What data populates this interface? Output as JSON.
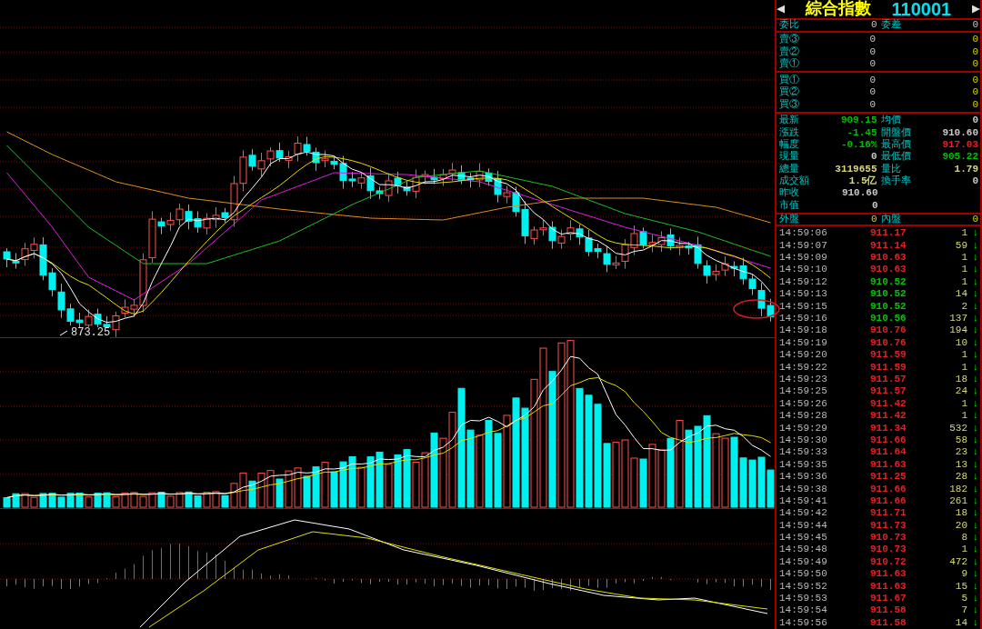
{
  "header": {
    "arrow_left": "◀",
    "title": "綜合指數",
    "code": "110001",
    "arrow_right": "▶"
  },
  "order_ratio": [
    {
      "label": "委比",
      "value": "0"
    },
    {
      "label": "委差",
      "value": "0"
    }
  ],
  "asks": [
    {
      "label": "賣③",
      "price": "0",
      "volume": "0"
    },
    {
      "label": "賣②",
      "price": "0",
      "volume": "0"
    },
    {
      "label": "賣①",
      "price": "0",
      "volume": "0"
    }
  ],
  "bids": [
    {
      "label": "買①",
      "price": "0",
      "volume": "0"
    },
    {
      "label": "買②",
      "price": "0",
      "volume": "0"
    },
    {
      "label": "買③",
      "price": "0",
      "volume": "0"
    }
  ],
  "quote": [
    [
      {
        "label": "最新",
        "value": "909.15",
        "color": "#00c000"
      },
      {
        "label": "均價",
        "value": "0",
        "color": "#c8c8c8"
      }
    ],
    [
      {
        "label": "漲跌",
        "value": "-1.45",
        "color": "#00c000"
      },
      {
        "label": "開盤價",
        "value": "910.60",
        "color": "#c8c8c8"
      }
    ],
    [
      {
        "label": "幅度",
        "value": "-0.16%",
        "color": "#00c000"
      },
      {
        "label": "最高價",
        "value": "917.03",
        "color": "#e82020"
      }
    ],
    [
      {
        "label": "現量",
        "value": "0",
        "color": "#c8c8c8"
      },
      {
        "label": "最低價",
        "value": "905.22",
        "color": "#00c000"
      }
    ],
    [
      {
        "label": "總量",
        "value": "3119655",
        "color": "#d8d878"
      },
      {
        "label": "量比",
        "value": "1.79",
        "color": "#d8d878"
      }
    ],
    [
      {
        "label": "成交額",
        "value": "1.5亿",
        "color": "#d8d878"
      },
      {
        "label": "換手率",
        "value": "0",
        "color": "#c8c8c8"
      }
    ],
    [
      {
        "label": "昨收",
        "value": "910.60",
        "color": "#c8c8c8"
      }
    ],
    [
      {
        "label": "市值",
        "value": "0",
        "color": "#c8c8c8"
      }
    ]
  ],
  "outer_inner": [
    {
      "label": "外盤",
      "value": "0"
    },
    {
      "label": "內盤",
      "value": "0"
    }
  ],
  "ticks": [
    {
      "time": "14:59:06",
      "price": "911.17",
      "color": "#e82020",
      "volume": "1",
      "arrow": "↓"
    },
    {
      "time": "14:59:07",
      "price": "911.14",
      "color": "#e82020",
      "volume": "59",
      "arrow": "↓"
    },
    {
      "time": "14:59:09",
      "price": "910.63",
      "color": "#e82020",
      "volume": "1",
      "arrow": "↓"
    },
    {
      "time": "14:59:10",
      "price": "910.63",
      "color": "#e82020",
      "volume": "1",
      "arrow": "↓"
    },
    {
      "time": "14:59:12",
      "price": "910.52",
      "color": "#00c800",
      "volume": "1",
      "arrow": "↓"
    },
    {
      "time": "14:59:13",
      "price": "910.52",
      "color": "#00c800",
      "volume": "14",
      "arrow": "↓"
    },
    {
      "time": "14:59:15",
      "price": "910.52",
      "color": "#00c800",
      "volume": "2",
      "arrow": "↓"
    },
    {
      "time": "14:59:16",
      "price": "910.56",
      "color": "#00c800",
      "volume": "137",
      "arrow": "↓"
    },
    {
      "time": "14:59:18",
      "price": "910.76",
      "color": "#e82020",
      "volume": "194",
      "arrow": "↓"
    },
    {
      "time": "14:59:19",
      "price": "910.76",
      "color": "#e82020",
      "volume": "10",
      "arrow": "↓"
    },
    {
      "time": "14:59:20",
      "price": "911.59",
      "color": "#e82020",
      "volume": "1",
      "arrow": "↓"
    },
    {
      "time": "14:59:22",
      "price": "911.59",
      "color": "#e82020",
      "volume": "1",
      "arrow": "↓"
    },
    {
      "time": "14:59:23",
      "price": "911.57",
      "color": "#e82020",
      "volume": "18",
      "arrow": "↓"
    },
    {
      "time": "14:59:25",
      "price": "911.57",
      "color": "#e82020",
      "volume": "24",
      "arrow": "↓"
    },
    {
      "time": "14:59:26",
      "price": "911.42",
      "color": "#e82020",
      "volume": "1",
      "arrow": "↓"
    },
    {
      "time": "14:59:28",
      "price": "911.42",
      "color": "#e82020",
      "volume": "1",
      "arrow": "↓"
    },
    {
      "time": "14:59:29",
      "price": "911.34",
      "color": "#e82020",
      "volume": "532",
      "arrow": "↓"
    },
    {
      "time": "14:59:30",
      "price": "911.66",
      "color": "#e82020",
      "volume": "58",
      "arrow": "↓"
    },
    {
      "time": "14:59:33",
      "price": "911.64",
      "color": "#e82020",
      "volume": "23",
      "arrow": "↓"
    },
    {
      "time": "14:59:35",
      "price": "911.63",
      "color": "#e82020",
      "volume": "13",
      "arrow": "↓"
    },
    {
      "time": "14:59:36",
      "price": "911.25",
      "color": "#e82020",
      "volume": "28",
      "arrow": "↓"
    },
    {
      "time": "14:59:38",
      "price": "911.66",
      "color": "#e82020",
      "volume": "182",
      "arrow": "↓"
    },
    {
      "time": "14:59:41",
      "price": "911.66",
      "color": "#e82020",
      "volume": "261",
      "arrow": "↓"
    },
    {
      "time": "14:59:42",
      "price": "911.71",
      "color": "#e82020",
      "volume": "18",
      "arrow": "↓"
    },
    {
      "time": "14:59:44",
      "price": "911.73",
      "color": "#e82020",
      "volume": "20",
      "arrow": "↓"
    },
    {
      "time": "14:59:45",
      "price": "910.73",
      "color": "#e82020",
      "volume": "8",
      "arrow": "↓"
    },
    {
      "time": "14:59:48",
      "price": "910.73",
      "color": "#e82020",
      "volume": "1",
      "arrow": "↓"
    },
    {
      "time": "14:59:49",
      "price": "910.72",
      "color": "#e82020",
      "volume": "472",
      "arrow": "↓"
    },
    {
      "time": "14:59:50",
      "price": "911.63",
      "color": "#e82020",
      "volume": "9",
      "arrow": "↓"
    },
    {
      "time": "14:59:52",
      "price": "911.63",
      "color": "#e82020",
      "volume": "15",
      "arrow": "↓"
    },
    {
      "time": "14:59:53",
      "price": "911.67",
      "color": "#e82020",
      "volume": "5",
      "arrow": "↓"
    },
    {
      "time": "14:59:54",
      "price": "911.58",
      "color": "#e82020",
      "volume": "7",
      "arrow": "↓"
    },
    {
      "time": "14:59:56",
      "price": "911.58",
      "color": "#e82020",
      "volume": "14",
      "arrow": "↓"
    }
  ],
  "chart": {
    "low_label": "873.25"
  }
}
